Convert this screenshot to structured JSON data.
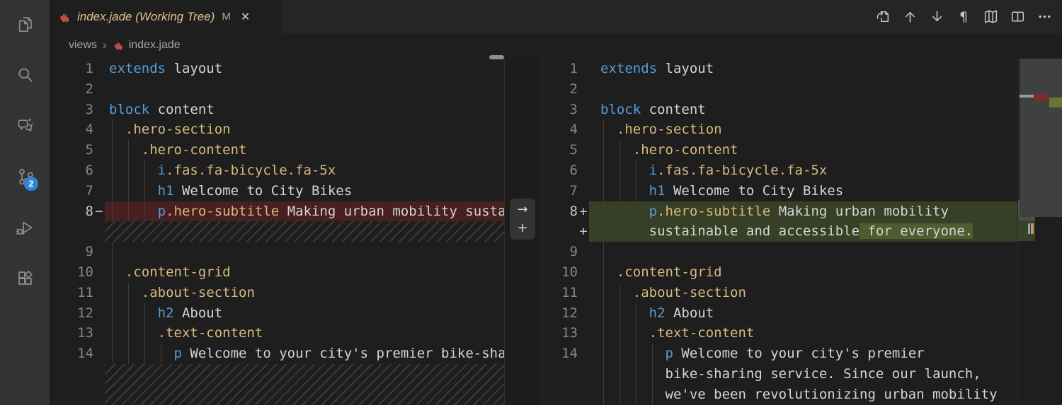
{
  "chrome": {
    "tab": {
      "title": "index.jade (Working Tree)",
      "modified_indicator": "M",
      "close_glyph": "✕",
      "file_icon": "pug-file-icon"
    },
    "breadcrumb": {
      "folder": "views",
      "separator": "›",
      "file": "index.jade"
    },
    "editor_actions": [
      {
        "name": "go-to-file"
      },
      {
        "name": "previous-change"
      },
      {
        "name": "next-change"
      },
      {
        "name": "show-whitespace",
        "glyph": "¶"
      },
      {
        "name": "accessible-diff-viewer-map"
      },
      {
        "name": "split-editor"
      },
      {
        "name": "more-actions"
      }
    ],
    "activity_bar": {
      "items": [
        "explorer",
        "search",
        "copilot-chat",
        "source-control",
        "run-and-debug",
        "extensions"
      ],
      "source_control_badge": "2"
    }
  },
  "diff": {
    "gutter_actions": {
      "revert_glyph": "→",
      "plus_glyph": "+"
    },
    "left_lines": [
      {
        "num": "1",
        "marker": "",
        "type": "code",
        "guides": 0,
        "tokens": [
          [
            "kw",
            "extends"
          ],
          [
            "pl",
            " layout"
          ]
        ]
      },
      {
        "num": "2",
        "marker": "",
        "type": "code",
        "guides": 0,
        "tokens": []
      },
      {
        "num": "3",
        "marker": "",
        "type": "code",
        "guides": 0,
        "tokens": [
          [
            "kw",
            "block"
          ],
          [
            "pl",
            " content"
          ]
        ]
      },
      {
        "num": "4",
        "marker": "",
        "type": "code",
        "guides": 1,
        "tokens": [
          [
            "pl",
            "  "
          ],
          [
            "cls",
            ".hero-section"
          ]
        ]
      },
      {
        "num": "5",
        "marker": "",
        "type": "code",
        "guides": 2,
        "tokens": [
          [
            "pl",
            "    "
          ],
          [
            "cls",
            ".hero-content"
          ]
        ]
      },
      {
        "num": "6",
        "marker": "",
        "type": "code",
        "guides": 3,
        "tokens": [
          [
            "pl",
            "      "
          ],
          [
            "kw",
            "i"
          ],
          [
            "cls",
            ".fas.fa-bicycle.fa-5x"
          ]
        ]
      },
      {
        "num": "7",
        "marker": "",
        "type": "code",
        "guides": 3,
        "tokens": [
          [
            "pl",
            "      "
          ],
          [
            "kw",
            "h1"
          ],
          [
            "pl",
            " Welcome to City Bikes"
          ]
        ]
      },
      {
        "num": "8",
        "marker": "−",
        "type": "removed",
        "guides": 3,
        "tokens": [
          [
            "pl",
            "      "
          ],
          [
            "kw",
            "p"
          ],
          [
            "cls",
            ".hero-subtitle"
          ],
          [
            "pl",
            " Making urban mobility sustainable and accessible for everyone."
          ]
        ]
      },
      {
        "num": "",
        "marker": "",
        "type": "hatch",
        "guides": 0,
        "span": 1,
        "tokens": []
      },
      {
        "num": "9",
        "marker": "",
        "type": "code",
        "guides": 1,
        "tokens": []
      },
      {
        "num": "10",
        "marker": "",
        "type": "code",
        "guides": 1,
        "tokens": [
          [
            "pl",
            "  "
          ],
          [
            "cls",
            ".content-grid"
          ]
        ]
      },
      {
        "num": "11",
        "marker": "",
        "type": "code",
        "guides": 2,
        "tokens": [
          [
            "pl",
            "    "
          ],
          [
            "cls",
            ".about-section"
          ]
        ]
      },
      {
        "num": "12",
        "marker": "",
        "type": "code",
        "guides": 3,
        "tokens": [
          [
            "pl",
            "      "
          ],
          [
            "kw",
            "h2"
          ],
          [
            "pl",
            " About"
          ]
        ]
      },
      {
        "num": "13",
        "marker": "",
        "type": "code",
        "guides": 3,
        "tokens": [
          [
            "pl",
            "      "
          ],
          [
            "cls",
            ".text-content"
          ]
        ]
      },
      {
        "num": "14",
        "marker": "",
        "type": "code",
        "guides": 4,
        "tokens": [
          [
            "pl",
            "        "
          ],
          [
            "kw",
            "p"
          ],
          [
            "pl",
            " Welcome to your city's premier bike-sharing service. Since our launch, we've been revolutionizing urban mobility"
          ]
        ]
      },
      {
        "num": "",
        "marker": "",
        "type": "hatch",
        "guides": 0,
        "span": 2,
        "tokens": []
      }
    ],
    "right_lines": [
      {
        "num": "1",
        "marker": "",
        "type": "code",
        "guides": 0,
        "tokens": [
          [
            "kw",
            "extends"
          ],
          [
            "pl",
            " layout"
          ]
        ]
      },
      {
        "num": "2",
        "marker": "",
        "type": "code",
        "guides": 0,
        "tokens": []
      },
      {
        "num": "3",
        "marker": "",
        "type": "code",
        "guides": 0,
        "tokens": [
          [
            "kw",
            "block"
          ],
          [
            "pl",
            " content"
          ]
        ]
      },
      {
        "num": "4",
        "marker": "",
        "type": "code",
        "guides": 1,
        "tokens": [
          [
            "pl",
            "  "
          ],
          [
            "cls",
            ".hero-section"
          ]
        ]
      },
      {
        "num": "5",
        "marker": "",
        "type": "code",
        "guides": 2,
        "tokens": [
          [
            "pl",
            "    "
          ],
          [
            "cls",
            ".hero-content"
          ]
        ]
      },
      {
        "num": "6",
        "marker": "",
        "type": "code",
        "guides": 3,
        "tokens": [
          [
            "pl",
            "      "
          ],
          [
            "kw",
            "i"
          ],
          [
            "cls",
            ".fas.fa-bicycle.fa-5x"
          ]
        ]
      },
      {
        "num": "7",
        "marker": "",
        "type": "code",
        "guides": 3,
        "tokens": [
          [
            "pl",
            "      "
          ],
          [
            "kw",
            "h1"
          ],
          [
            "pl",
            " Welcome to City Bikes"
          ]
        ]
      },
      {
        "num": "8",
        "marker": "+",
        "type": "added",
        "guides": 3,
        "tokens": [
          [
            "pl",
            "      "
          ],
          [
            "kw",
            "p"
          ],
          [
            "cls",
            ".hero-subtitle"
          ],
          [
            "pl",
            " Making urban mobility"
          ]
        ]
      },
      {
        "num": "",
        "marker": "+",
        "type": "added",
        "guides": 3,
        "tokens": [
          [
            "pl",
            "      "
          ],
          [
            "pl",
            "sustainable and accessible"
          ],
          [
            "ins",
            " for everyone."
          ]
        ]
      },
      {
        "num": "9",
        "marker": "",
        "type": "code",
        "guides": 1,
        "tokens": []
      },
      {
        "num": "10",
        "marker": "",
        "type": "code",
        "guides": 1,
        "tokens": [
          [
            "pl",
            "  "
          ],
          [
            "cls",
            ".content-grid"
          ]
        ]
      },
      {
        "num": "11",
        "marker": "",
        "type": "code",
        "guides": 2,
        "tokens": [
          [
            "pl",
            "    "
          ],
          [
            "cls",
            ".about-section"
          ]
        ]
      },
      {
        "num": "12",
        "marker": "",
        "type": "code",
        "guides": 3,
        "tokens": [
          [
            "pl",
            "      "
          ],
          [
            "kw",
            "h2"
          ],
          [
            "pl",
            " About"
          ]
        ]
      },
      {
        "num": "13",
        "marker": "",
        "type": "code",
        "guides": 3,
        "tokens": [
          [
            "pl",
            "      "
          ],
          [
            "cls",
            ".text-content"
          ]
        ]
      },
      {
        "num": "14",
        "marker": "",
        "type": "code",
        "guides": 4,
        "tokens": [
          [
            "pl",
            "        "
          ],
          [
            "kw",
            "p"
          ],
          [
            "pl",
            " Welcome to your city's premier"
          ]
        ]
      },
      {
        "num": "",
        "marker": "",
        "type": "code",
        "guides": 4,
        "tokens": [
          [
            "pl",
            "        "
          ],
          [
            "pl",
            "bike-sharing service. Since our launch,"
          ]
        ]
      },
      {
        "num": "",
        "marker": "",
        "type": "code",
        "guides": 4,
        "tokens": [
          [
            "pl",
            "        "
          ],
          [
            "pl",
            "we've been revolutionizing urban mobility"
          ]
        ]
      }
    ]
  },
  "colors": {
    "editor_bg": "#1e1e1e",
    "chrome_bg": "#252526",
    "activity_bar_bg": "#333333",
    "tab_modified_fg": "#e2c08d",
    "badge_bg": "#2f86d4",
    "line_number": "#858585",
    "keyword": "#569cd6",
    "class_name": "#d7ba7d",
    "text": "#d4d4d4",
    "removed_line_bg": "#47201f",
    "added_line_bg": "#373f26",
    "added_text_bg": "#4e5c2f",
    "hatch_stripe": "#3a3a3a",
    "file_icon_red": "#c24b4b"
  }
}
